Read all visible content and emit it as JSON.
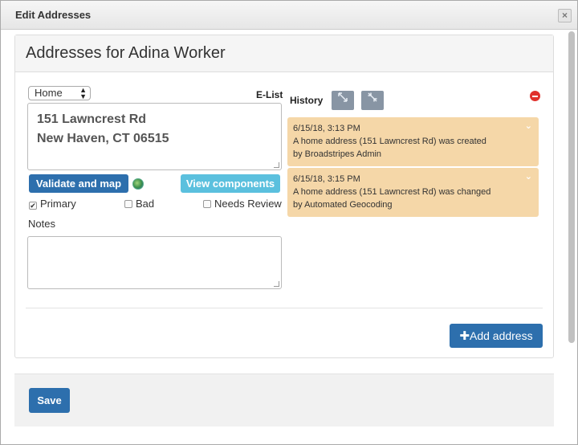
{
  "window": {
    "title": "Edit Addresses",
    "close_symbol": "×"
  },
  "panel": {
    "heading": "Addresses for Adina Worker"
  },
  "address": {
    "type_value": "Home",
    "line1": "151 Lawncrest Rd",
    "line2": "New Haven, CT 06515",
    "elist_label": "E-List",
    "validate_label": "Validate and map",
    "view_components_label": "View components",
    "checkboxes": [
      {
        "label": "Primary",
        "checked": true,
        "mark": "✔"
      },
      {
        "label": "Bad",
        "checked": false
      },
      {
        "label": "Needs Review",
        "checked": false
      }
    ],
    "notes_label": "Notes",
    "notes_value": ""
  },
  "history": {
    "label": "History",
    "expand_icon": "expand-icon",
    "collapse_icon": "collapse-icon",
    "entries": [
      {
        "time": "6/15/18, 3:13 PM",
        "text": "A home address (151 Lawncrest Rd) was created",
        "by": "by Broadstripes Admin"
      },
      {
        "time": "6/15/18, 3:15 PM",
        "text": "A home address (151 Lawncrest Rd) was changed",
        "by": "by Automated Geocoding"
      }
    ]
  },
  "actions": {
    "add_label": "Add address",
    "add_plus": "✚",
    "save_label": "Save"
  },
  "colors": {
    "primary": "#2d6fad",
    "info": "#5bc0de",
    "history_bg": "#f5d7a8",
    "danger": "#e0312c"
  }
}
